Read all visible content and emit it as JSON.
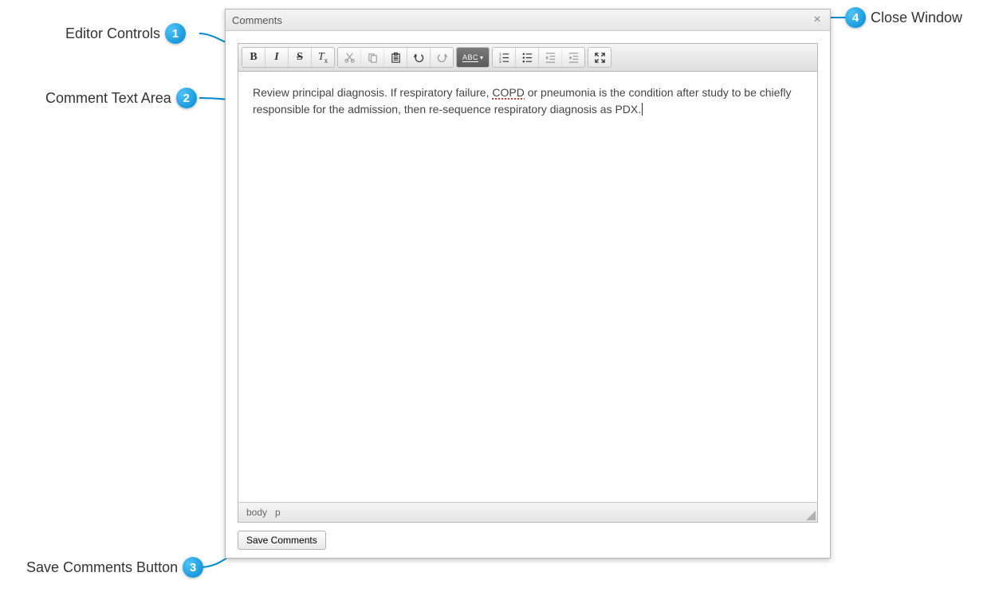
{
  "dialog": {
    "title": "Comments"
  },
  "editor": {
    "content_parts": {
      "pre": "Review principal diagnosis. If respiratory failure, ",
      "spell": "COPD",
      "post1": " or pneumonia is the condition after study to be chiefly responsible for the admission, then re-sequence respiratory diagnosis as PDX."
    },
    "status": {
      "crumb1": "body",
      "crumb2": "p"
    },
    "toolbar_labels": {
      "bold": "B",
      "italic": "I",
      "strike": "S",
      "abc": "ABC"
    },
    "save_label": "Save Comments"
  },
  "callouts": {
    "1": "Editor Controls",
    "2": "Comment Text Area",
    "3": "Save Comments Button",
    "4": "Close Window"
  }
}
